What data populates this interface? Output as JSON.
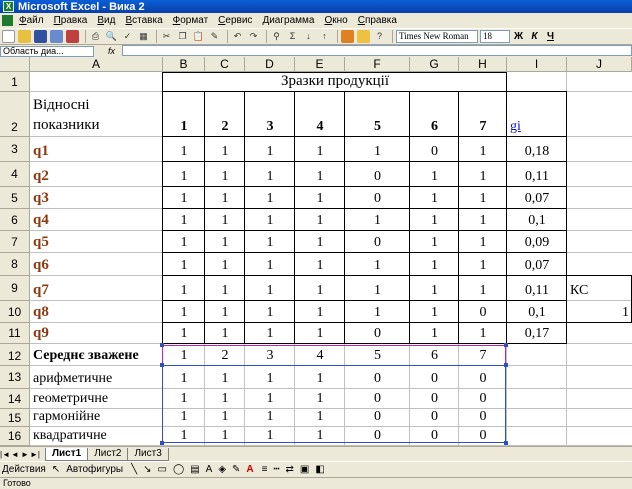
{
  "window": {
    "title": "Microsoft Excel - Вика 2"
  },
  "menu": [
    "Файл",
    "Правка",
    "Вид",
    "Вставка",
    "Формат",
    "Сервис",
    "Диаграмма",
    "Окно",
    "Справка"
  ],
  "toolbar": {
    "font_name": "Times New Roman",
    "font_size": "18",
    "bold": "Ж",
    "italic": "К",
    "underline": "Ч"
  },
  "formula_bar": {
    "name_box": "Область диа...",
    "fx": "fx"
  },
  "columns": [
    "A",
    "B",
    "C",
    "D",
    "E",
    "F",
    "G",
    "H",
    "I",
    "J"
  ],
  "rows": [
    "1",
    "2",
    "3",
    "4",
    "5",
    "6",
    "7",
    "8",
    "9",
    "10",
    "11",
    "12",
    "13",
    "14",
    "15",
    "16"
  ],
  "sheet": {
    "header_title": "Зразки продукції",
    "a2_line1": "Відносні",
    "a2_line2": "показники",
    "sample_numbers": [
      "1",
      "2",
      "3",
      "4",
      "5",
      "6",
      "7"
    ],
    "gi_label": "gi",
    "indicators": [
      {
        "name": "q1",
        "values": [
          "1",
          "1",
          "1",
          "1",
          "1",
          "0",
          "1"
        ],
        "gi": "0,18"
      },
      {
        "name": "q2",
        "values": [
          "1",
          "1",
          "1",
          "1",
          "0",
          "1",
          "1"
        ],
        "gi": "0,11"
      },
      {
        "name": "q3",
        "values": [
          "1",
          "1",
          "1",
          "1",
          "0",
          "1",
          "1"
        ],
        "gi": "0,07"
      },
      {
        "name": "q4",
        "values": [
          "1",
          "1",
          "1",
          "1",
          "1",
          "1",
          "1"
        ],
        "gi": "0,1"
      },
      {
        "name": "q5",
        "values": [
          "1",
          "1",
          "1",
          "1",
          "0",
          "1",
          "1"
        ],
        "gi": "0,09"
      },
      {
        "name": "q6",
        "values": [
          "1",
          "1",
          "1",
          "1",
          "1",
          "1",
          "1"
        ],
        "gi": "0,07"
      },
      {
        "name": "q7",
        "values": [
          "1",
          "1",
          "1",
          "1",
          "1",
          "1",
          "1"
        ],
        "gi": "0,11"
      },
      {
        "name": "q8",
        "values": [
          "1",
          "1",
          "1",
          "1",
          "1",
          "1",
          "0"
        ],
        "gi": "0,1"
      },
      {
        "name": "q9",
        "values": [
          "1",
          "1",
          "1",
          "1",
          "0",
          "1",
          "1"
        ],
        "gi": "0,17"
      }
    ],
    "kc_label": "КС",
    "kc_value": "1",
    "avg_label": "Середнє зважене",
    "avg_rows": [
      {
        "name": "арифметичне",
        "values": [
          "1",
          "1",
          "1",
          "1",
          "0",
          "0",
          "0"
        ]
      },
      {
        "name": "геометричне",
        "values": [
          "1",
          "1",
          "1",
          "1",
          "0",
          "0",
          "0"
        ]
      },
      {
        "name": "гармонійне",
        "values": [
          "1",
          "1",
          "1",
          "1",
          "0",
          "0",
          "0"
        ]
      },
      {
        "name": "квадратичне",
        "values": [
          "1",
          "1",
          "1",
          "1",
          "0",
          "0",
          "0"
        ]
      }
    ]
  },
  "tabs": [
    "Лист1",
    "Лист2",
    "Лист3"
  ],
  "drawing": {
    "actions": "Действия",
    "autoshapes": "Автофигуры"
  },
  "status": "Готово",
  "colors": {
    "indicator": "#8b3a0f",
    "gi": "#1010c0",
    "selection": "#c020c0"
  }
}
